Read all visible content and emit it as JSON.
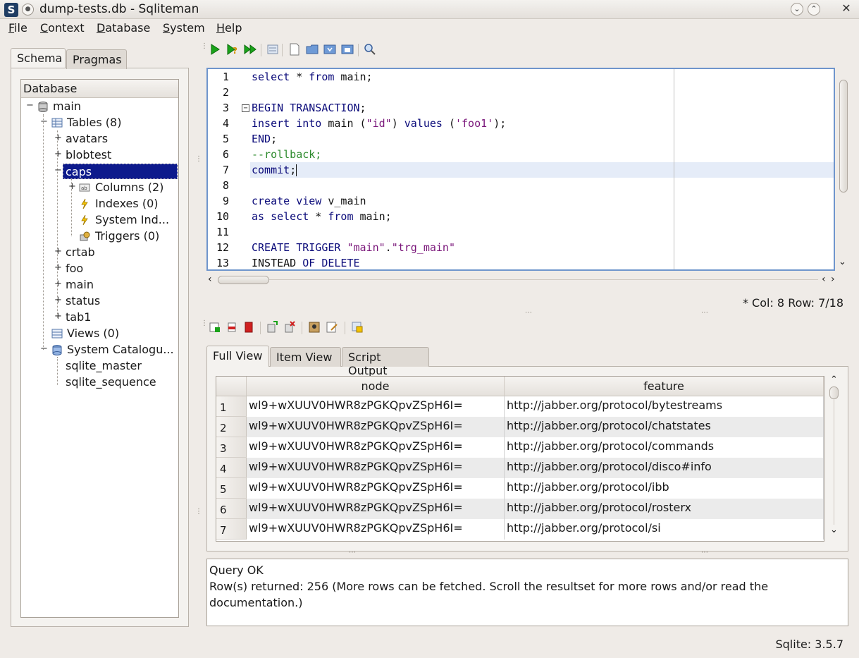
{
  "window": {
    "title": "dump-tests.db - Sqliteman",
    "app_icon": "S",
    "buttons": [
      "minimize",
      "maximize",
      "close"
    ]
  },
  "menu": [
    "File",
    "Context",
    "Database",
    "System",
    "Help"
  ],
  "left_tabs": [
    "Schema",
    "Pragmas"
  ],
  "tree": {
    "header": "Database",
    "nodes": {
      "main": "main",
      "tables": "Tables (8)",
      "avatars": "avatars",
      "blobtest": "blobtest",
      "caps": "caps",
      "columns": "Columns (2)",
      "indexes": "Indexes (0)",
      "system_indexes": "System Ind...",
      "triggers": "Triggers (0)",
      "crtab": "crtab",
      "foo": "foo",
      "main_table": "main",
      "status": "status",
      "tab1": "tab1",
      "views": "Views (0)",
      "system_catalogue": "System Catalogu...",
      "sqlite_master": "sqlite_master",
      "sqlite_sequence": "sqlite_sequence"
    }
  },
  "editor": {
    "line_numbers": [
      "1",
      "2",
      "3",
      "4",
      "5",
      "6",
      "7",
      "8",
      "9",
      "10",
      "11",
      "12",
      "13"
    ],
    "fold_marker": "−",
    "l1": {
      "a": "select",
      "b": " * ",
      "c": "from",
      "d": " main;"
    },
    "l3": {
      "a": "BEGIN TRANSACTION",
      "b": ";"
    },
    "l4": {
      "a": "insert into",
      "b": " main (",
      "c": "\"id\"",
      "d": ") ",
      "e": "values",
      "f": " (",
      "g": "'foo1'",
      "h": ");"
    },
    "l5": {
      "a": "END",
      "b": ";"
    },
    "l6": {
      "a": "--rollback;"
    },
    "l7": {
      "a": "commit",
      "b": ";"
    },
    "l9": {
      "a": "create view",
      "b": " v_main"
    },
    "l10": {
      "a": "as select",
      "b": " * ",
      "c": "from",
      "d": " main;"
    },
    "l12": {
      "a": "CREATE TRIGGER",
      "b": " ",
      "c": "\"main\"",
      "d": ".",
      "e": "\"trg_main\""
    },
    "l13": {
      "a": "INSTEAD",
      "b": " ",
      "c": "OF DELETE"
    }
  },
  "status": {
    "cursor": "* Col: 8 Row: 7/18",
    "sqlite_version": "Sqlite: 3.5.7"
  },
  "result_tabs": [
    "Full View",
    "Item View",
    "Script Output"
  ],
  "grid": {
    "columns": [
      "node",
      "feature"
    ],
    "rows": [
      {
        "n": "1",
        "node": "wl9+wXUUV0HWR8zPGKQpvZSpH6I=",
        "feature": "http://jabber.org/protocol/bytestreams"
      },
      {
        "n": "2",
        "node": "wl9+wXUUV0HWR8zPGKQpvZSpH6I=",
        "feature": "http://jabber.org/protocol/chatstates"
      },
      {
        "n": "3",
        "node": "wl9+wXUUV0HWR8zPGKQpvZSpH6I=",
        "feature": "http://jabber.org/protocol/commands"
      },
      {
        "n": "4",
        "node": "wl9+wXUUV0HWR8zPGKQpvZSpH6I=",
        "feature": "http://jabber.org/protocol/disco#info"
      },
      {
        "n": "5",
        "node": "wl9+wXUUV0HWR8zPGKQpvZSpH6I=",
        "feature": "http://jabber.org/protocol/ibb"
      },
      {
        "n": "6",
        "node": "wl9+wXUUV0HWR8zPGKQpvZSpH6I=",
        "feature": "http://jabber.org/protocol/rosterx"
      },
      {
        "n": "7",
        "node": "wl9+wXUUV0HWR8zPGKQpvZSpH6I=",
        "feature": "http://jabber.org/protocol/si"
      }
    ]
  },
  "message": {
    "line1": "Query OK",
    "line2": "Row(s) returned: 256 (More rows can be fetched. Scroll the resultset for more rows and/or read the documentation.)"
  },
  "icons": {
    "run": "run-icon",
    "explain": "explain-icon",
    "run_script": "run-script-icon",
    "history": "history-icon",
    "new_file": "new-file-icon",
    "open_file": "open-file-icon",
    "save_file": "save-file-icon",
    "save_as": "save-as-icon",
    "search": "search-icon"
  },
  "colors": {
    "keyword": "#0b0b7a",
    "string": "#7a167a",
    "comment": "#2e8b2e",
    "selection": "#0d1a8c",
    "editor_border": "#6f95cc"
  }
}
